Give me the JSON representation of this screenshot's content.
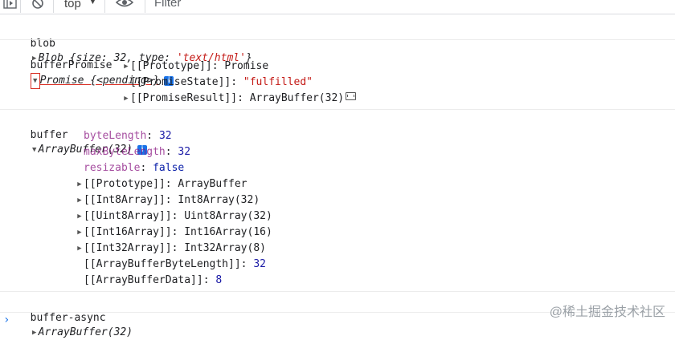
{
  "toolbar": {
    "context": "top",
    "context_arrow": "▼",
    "filter_placeholder": "Filter"
  },
  "entries": {
    "blob": {
      "name": "blob",
      "value": "Blob {size: 32, type: ",
      "type_string": "'text/html'",
      "close": "}"
    },
    "bufferPromise": {
      "name": "bufferPromise",
      "value": "Promise {<pending>}",
      "info": "i",
      "children": [
        {
          "tri": "▶",
          "key": "[[Prototype]]",
          "sep": ": ",
          "value": "Promise"
        },
        {
          "tri": "",
          "key": "[[PromiseState]]",
          "sep": ": ",
          "value": "\"fulfilled\""
        },
        {
          "tri": "▶",
          "key": "[[PromiseResult]]",
          "sep": ": ",
          "value": "ArrayBuffer(32)"
        }
      ]
    },
    "buffer": {
      "name": "buffer",
      "value": "ArrayBuffer(32)",
      "info": "i",
      "children": [
        {
          "tri": "",
          "key": "byteLength",
          "sep": ": ",
          "value": "32"
        },
        {
          "tri": "",
          "key": "maxByteLength",
          "sep": ": ",
          "value": "32"
        },
        {
          "tri": "",
          "key": "resizable",
          "sep": ": ",
          "value": "false"
        },
        {
          "tri": "▶",
          "key": "[[Prototype]]",
          "sep": ": ",
          "value": "ArrayBuffer"
        },
        {
          "tri": "▶",
          "key": "[[Int8Array]]",
          "sep": ": ",
          "value": "Int8Array(32)"
        },
        {
          "tri": "▶",
          "key": "[[Uint8Array]]",
          "sep": ": ",
          "value": "Uint8Array(32)"
        },
        {
          "tri": "▶",
          "key": "[[Int16Array]]",
          "sep": ": ",
          "value": "Int16Array(16)"
        },
        {
          "tri": "▶",
          "key": "[[Int32Array]]",
          "sep": ": ",
          "value": "Int32Array(8)"
        },
        {
          "tri": "",
          "key": "[[ArrayBufferByteLength]]",
          "sep": ": ",
          "value": "32"
        },
        {
          "tri": "",
          "key": "[[ArrayBufferData]]",
          "sep": ": ",
          "value": "8"
        }
      ]
    },
    "bufferAsync": {
      "name": "buffer-async",
      "value": "ArrayBuffer(32)"
    }
  },
  "prompt": "›",
  "watermark": "@稀土掘金技术社区",
  "colors": {
    "info_badge": "#1a73e8",
    "string": "#c41a16",
    "number": "#1a1aa6",
    "property": "#881280",
    "annotation": "#d93025"
  },
  "icons": [
    "sidebar-toggle-icon",
    "clear-console-icon",
    "eye-icon",
    "memory-inspector-icon",
    "expand-triangle-icon",
    "info-icon"
  ]
}
